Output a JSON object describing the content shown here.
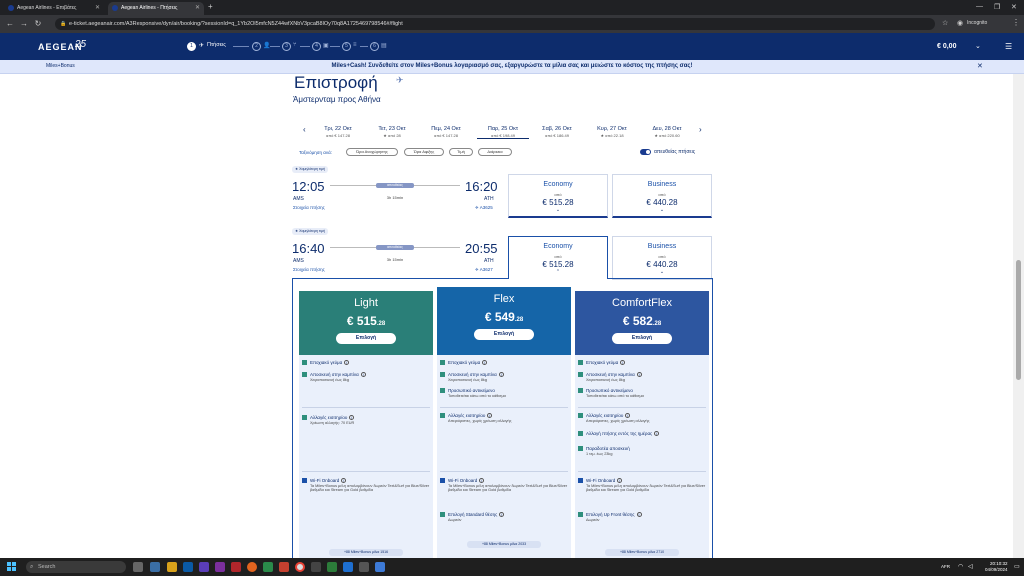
{
  "browser": {
    "tabs": [
      {
        "title": "Aegean Airlines - Επιβάτες"
      },
      {
        "title": "Aegean Airlines - Πτήσεις"
      }
    ],
    "url": "e-ticket.aegeanair.com/A3Responsive/dyn/air/booking/?sessionId=q_1Yb2Ol5mfcN5Z44wfXNbV3pcaB8lOy70q8A1725469798546#/flight",
    "profile": "Incognito"
  },
  "header": {
    "logo": "AEGEAN",
    "logo_badge": "25",
    "steps": [
      "1",
      "2",
      "3",
      "4",
      "5",
      "6"
    ],
    "step1_label": "Πτήσεις",
    "total_price": "€ 0,00",
    "price_chevron": "⌄"
  },
  "banner": {
    "left_label": "Miles+Bonus",
    "text": "Miles+Cash! Συνδεθείτε στον Miles+Bonus λογαριασμό σας, εξαργυρώστε τα μίλια σας και μειώστε το κόστος της πτήσης σας!"
  },
  "page": {
    "title": "Επιστροφή",
    "subtitle": "Άμστερνταμ προς Αθήνα"
  },
  "dates": [
    {
      "day": "Τρι, 22 Οκτ",
      "price": "από € 147.28"
    },
    {
      "day": "Τετ, 23 Οκτ",
      "price": "★ από 28"
    },
    {
      "day": "Πεμ, 24 Οκτ",
      "price": "από € 147.28"
    },
    {
      "day": "Παρ, 25 Οκτ",
      "price": "από € 198.49"
    },
    {
      "day": "Σαβ, 26 Οκτ",
      "price": "από € 186.49"
    },
    {
      "day": "Κυρ, 27 Οκτ",
      "price": "★ από 22.18"
    },
    {
      "day": "Δευ, 28 Οκτ",
      "price": "★ από 220.60"
    }
  ],
  "sort": {
    "label": "Ταξινόμηση ανά:",
    "options": [
      "Ώρα Αναχώρησης",
      "Ώρα Αφιξης",
      "Τιμή",
      "Διάρκεια"
    ],
    "toggle_label": "απευθείας πτήσεις"
  },
  "flights": [
    {
      "badge": "★ Χαμηλότερη τιμή",
      "dep_time": "12:05",
      "dep_code": "AMS",
      "arr_time": "16:20",
      "arr_code": "ATH",
      "stops": "απευθείας",
      "duration": "3h 15min",
      "details": "Στοιχεία πτήσης",
      "flight_no": "✈ A3625",
      "economy": {
        "name": "Economy",
        "from": "από",
        "price": "€ 515.28"
      },
      "business": {
        "name": "Business",
        "from": "από",
        "price": "€ 440.28"
      }
    },
    {
      "badge": "★ Χαμηλότερη τιμή",
      "dep_time": "16:40",
      "dep_code": "AMS",
      "arr_time": "20:55",
      "arr_code": "ATH",
      "stops": "απευθείας",
      "duration": "3h 15min",
      "details": "Στοιχεία πτήσης",
      "flight_no": "✈ A3627",
      "economy": {
        "name": "Economy",
        "from": "από",
        "price": "€ 515.28"
      },
      "business": {
        "name": "Business",
        "from": "από",
        "price": "€ 440.28"
      }
    }
  ],
  "fares": [
    {
      "name": "Light",
      "price_main": "€ 515",
      "price_dec": ".28",
      "select": "Επιλογή",
      "color": "#2a7f78",
      "features": [
        {
          "title": "Εποχιακό γεύμα",
          "sub": ""
        },
        {
          "title": "Αποσκευή στην καμπίνα",
          "sub": "Χειραποσκευή έως 8kg"
        },
        {
          "title": "Αλλαγές εισιτηρίου",
          "sub": "Χρέωση αλλαγής: 70 EUR"
        },
        {
          "title": "Wi-Fi Onboard",
          "sub": "Τα Miles+Bonus μέλη απολαμβάνουν δωρεάν Text&Surf για Blue/Silver βαθμίδα και Stream για Gold βαθμίδα"
        }
      ],
      "miles": "+88 Miles+Bonus μίλια 1516"
    },
    {
      "name": "Flex",
      "price_main": "€ 549",
      "price_dec": ".28",
      "select": "Επιλογή",
      "color": "#1565a8",
      "features": [
        {
          "title": "Εποχιακό γεύμα",
          "sub": ""
        },
        {
          "title": "Αποσκευή στην καμπίνα",
          "sub": "Χειραποσκευή έως 8kg"
        },
        {
          "title": "Προσωπικό αντικείμενο",
          "sub": "Τοποθετείται κάτω από το κάθισμα"
        },
        {
          "title": "Αλλαγές εισιτηρίου",
          "sub": "Απεριόριστες, χωρίς χρέωση αλλαγής"
        },
        {
          "title": "Wi-Fi Onboard",
          "sub": "Τα Miles+Bonus μέλη απολαμβάνουν δωρεάν Text&Surf για Blue/Silver βαθμίδα και Stream για Gold βαθμίδα"
        },
        {
          "title": "Επιλογή Standard θέσης",
          "sub": "Δωρεάν"
        }
      ],
      "miles": "+88 Miles+Bonus μίλια 2033"
    },
    {
      "name": "ComfortFlex",
      "price_main": "€ 582",
      "price_dec": ".28",
      "select": "Επιλογή",
      "color": "#2d56a0",
      "features": [
        {
          "title": "Εποχιακό γεύμα",
          "sub": ""
        },
        {
          "title": "Αποσκευή στην καμπίνα",
          "sub": "Χειραποσκευή έως 8kg"
        },
        {
          "title": "Προσωπικό αντικείμενο",
          "sub": "Τοποθετείται κάτω από το κάθισμα"
        },
        {
          "title": "Αλλαγές εισιτηρίου",
          "sub": "Απεριόριστες, χωρίς χρέωση αλλαγής"
        },
        {
          "title": "Αλλαγή πτήσης εντός της ημέρας",
          "sub": ""
        },
        {
          "title": "Παραδοτέα αποσκευή",
          "sub": "1 τεμ. έως 23kg"
        },
        {
          "title": "Wi-Fi Onboard",
          "sub": "Τα Miles+Bonus μέλη απολαμβάνουν δωρεάν Text&Surf για Blue/Silver βαθμίδα και Stream για Gold βαθμίδα"
        },
        {
          "title": "Επιλογή Up Front θέσης",
          "sub": "Δωρεάν"
        }
      ],
      "miles": "+88 Miles+Bonus μίλια 2710"
    }
  ],
  "taskbar": {
    "search": "Search",
    "lang": "AFR",
    "time": "20:10:32",
    "date": "04/09/2024"
  }
}
